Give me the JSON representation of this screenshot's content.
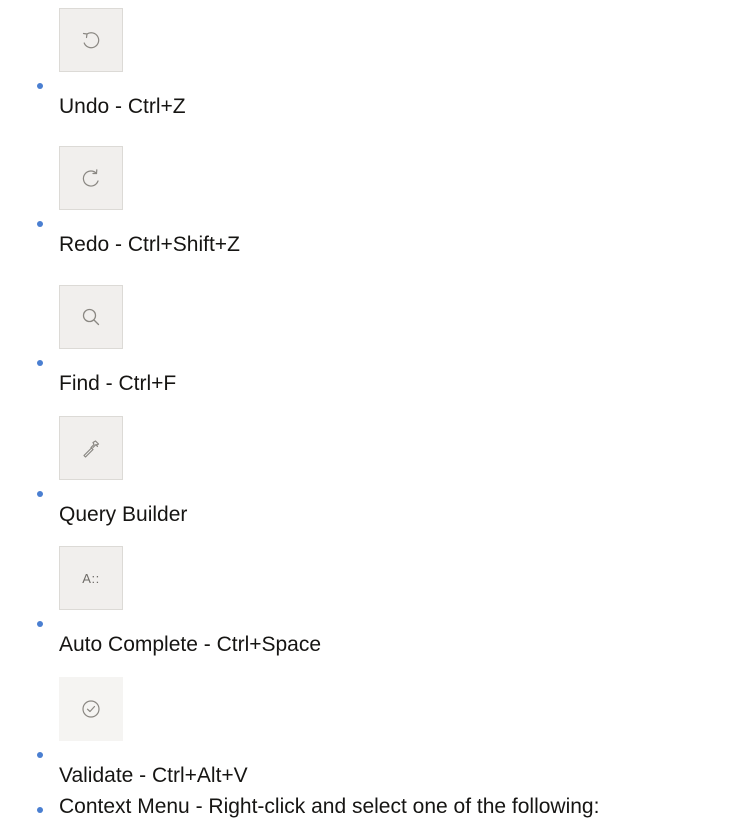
{
  "items": [
    {
      "icon": "undo-icon",
      "label": "Undo - Ctrl+Z"
    },
    {
      "icon": "redo-icon",
      "label": "Redo - Ctrl+Shift+Z"
    },
    {
      "icon": "search-icon",
      "label": "Find - Ctrl+F"
    },
    {
      "icon": "hammer-icon",
      "label": "Query Builder"
    },
    {
      "icon": "auto-complete-icon",
      "label": "Auto Complete - Ctrl+Space",
      "icon_text": "A::"
    },
    {
      "icon": "check-circle-icon",
      "label": "Validate - Ctrl+Alt+V"
    },
    {
      "label": "Context Menu - Right-click and select one of the following:"
    }
  ],
  "colors": {
    "bullet": "#4a7fd1",
    "icon_stroke": "#8a8782",
    "button_bg": "#f1efed",
    "button_border": "#dcdad6",
    "text": "#161513"
  }
}
